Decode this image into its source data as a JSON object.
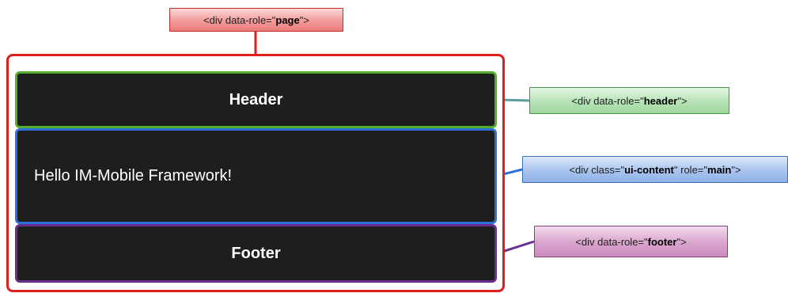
{
  "colors": {
    "page_border": "#e01e1e",
    "header_border": "#55ad2e",
    "content_border": "#2d6fd6",
    "footer_border": "#6a2e8f",
    "region_fill": "#1e1e1e",
    "region_text": "#ffffff"
  },
  "regions": {
    "header_title": "Header",
    "content_text": "Hello IM-Mobile Framework!",
    "footer_title": "Footer"
  },
  "callouts": {
    "page": {
      "prefix": "<div data-role=\"",
      "value": "page",
      "suffix": "\">"
    },
    "header": {
      "prefix": "<div data-role=\"",
      "value": "header",
      "suffix": "\">"
    },
    "content": {
      "prefix": "<div class=\"",
      "value": "ui-content",
      "middle": "\" role=\"",
      "value2": "main",
      "suffix": "\">"
    },
    "footer": {
      "prefix": "<div data-role=\"",
      "value": "footer",
      "suffix": "\">"
    }
  }
}
